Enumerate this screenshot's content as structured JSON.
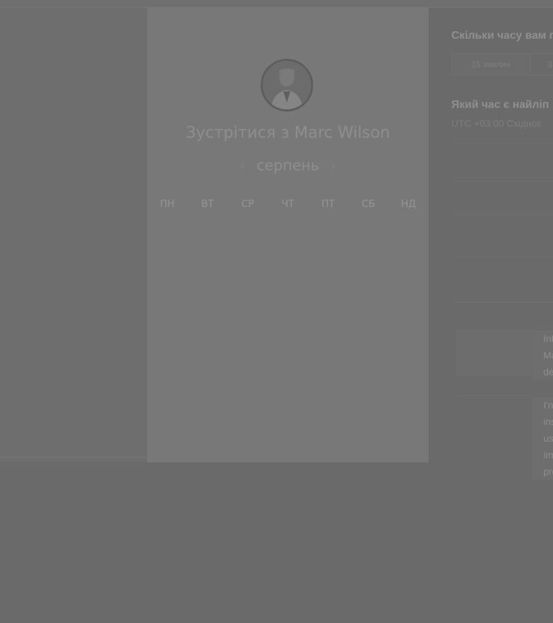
{
  "card": {
    "title": "Зустрітися з Marc Wilson",
    "month": "серпень",
    "prev_icon": "‹",
    "next_icon": "›",
    "weekdays": [
      "ПН",
      "ВТ",
      "СР",
      "ЧТ",
      "ПТ",
      "СБ",
      "НД"
    ]
  },
  "right": {
    "duration_question": "Скільки часу вам п",
    "duration_options": [
      "15 хвилин",
      "3"
    ],
    "time_question": "Який час є найліп",
    "timezone": "UTC +03:00 Східноє",
    "message_lines_1": [
      "Int",
      "Ma",
      "de"
    ],
    "message_lines_2": [
      "I'n",
      "ins",
      "us",
      "im",
      "pro"
    ]
  }
}
